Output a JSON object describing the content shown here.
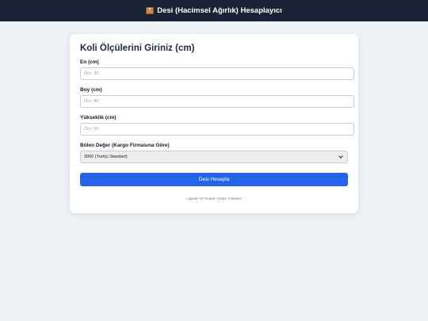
{
  "header": {
    "icon": "package-icon",
    "title": "Desi (Hacimsel Ağırlık) Hesaplayıcı"
  },
  "card": {
    "title": "Koli Ölçülerini Giriniz (cm)",
    "fields": [
      {
        "label": "En (cm)",
        "placeholder": "Örn: 30",
        "value": ""
      },
      {
        "label": "Boy (cm)",
        "placeholder": "Örn: 40",
        "value": ""
      },
      {
        "label": "Yükseklik (cm)",
        "placeholder": "Örn: 50",
        "value": ""
      }
    ],
    "divisor": {
      "label": "Bölen Değer (Kargo Firmasına Göre)",
      "selected": "3000 (Yurtiçi Standart)"
    },
    "submit_label": "Desi Hesapla",
    "footer": "Lojistik • E-Ticaret • Depo Yönetimi"
  },
  "colors": {
    "header_bg": "#1b2235",
    "button": "#2563eb",
    "page_bg": "#eef2f7"
  }
}
